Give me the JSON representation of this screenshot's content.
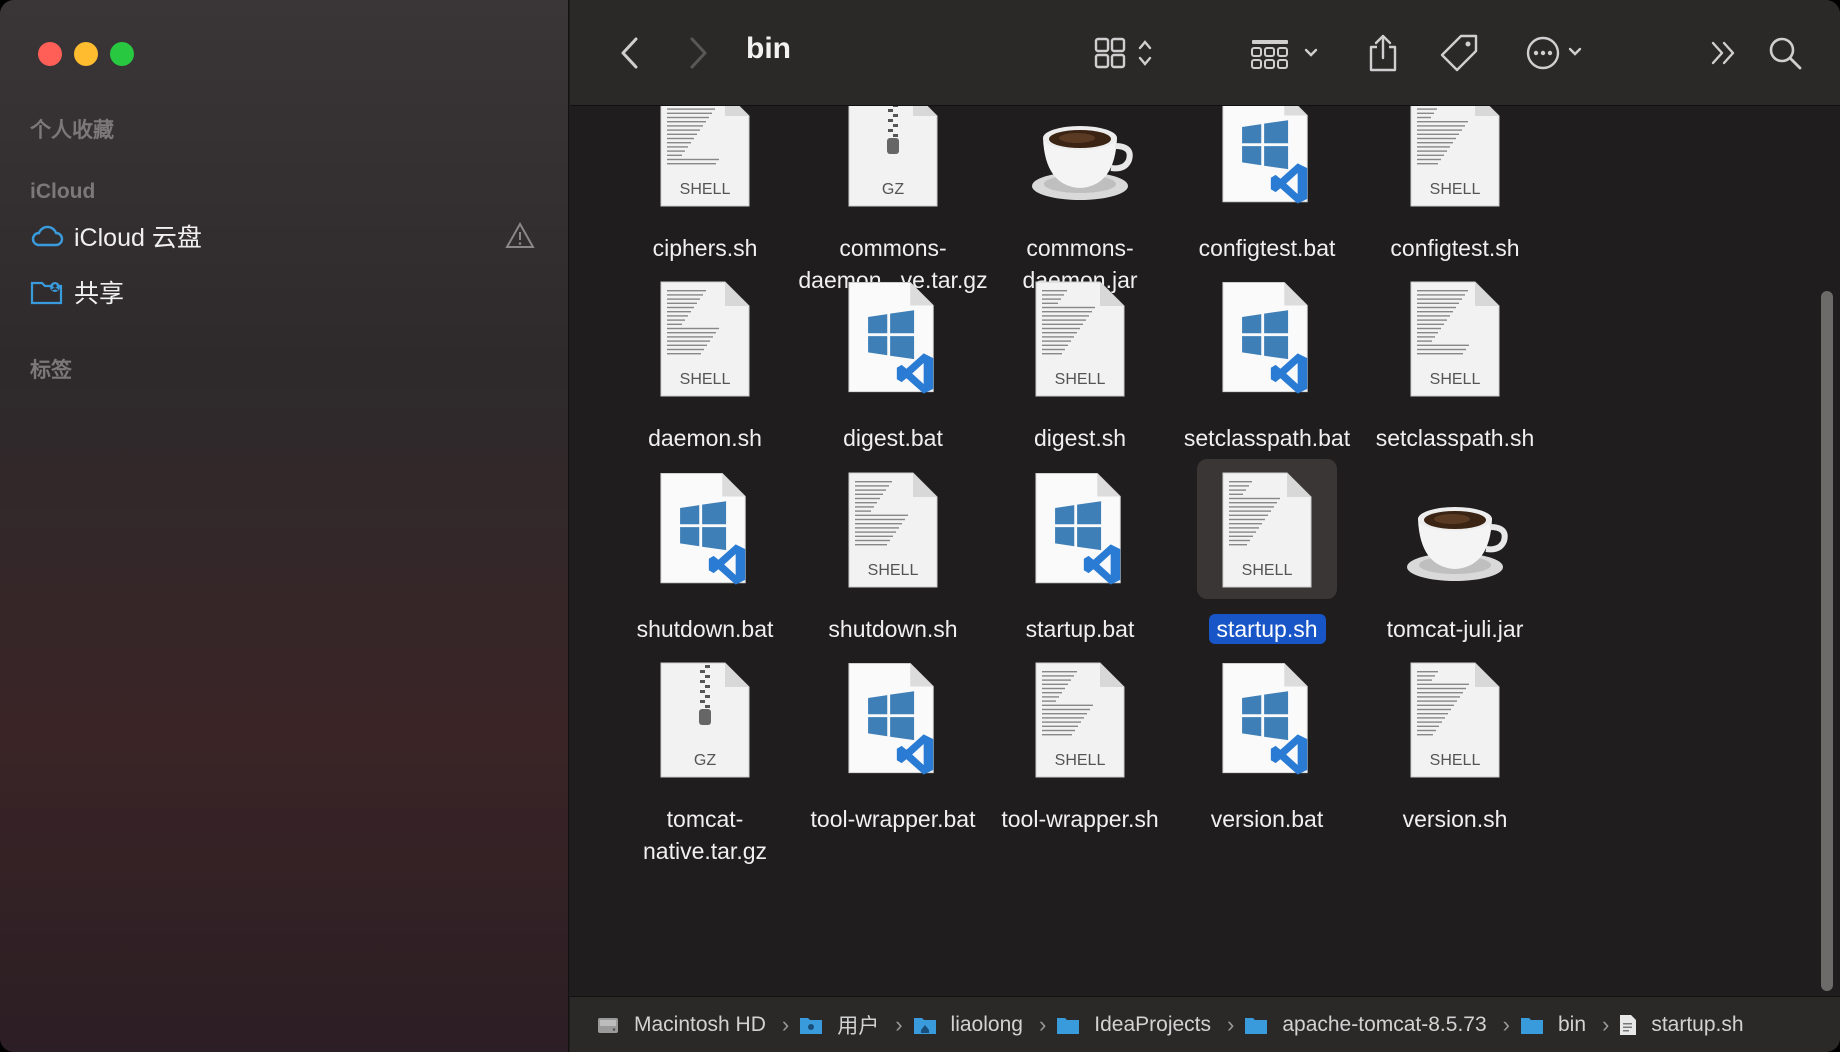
{
  "sidebar": {
    "favorites_header": "个人收藏",
    "icloud_header": "iCloud",
    "items": [
      {
        "label": "iCloud 云盘",
        "icon": "cloud-icon"
      },
      {
        "label": "共享",
        "icon": "shared-folder-icon"
      }
    ],
    "tags_header": "标签"
  },
  "toolbar": {
    "title": "bin",
    "icons": [
      "back-icon",
      "forward-icon",
      "icon-view-icon",
      "group-icon",
      "share-icon",
      "tag-icon",
      "more-icon",
      "overflow-icon",
      "search-icon"
    ]
  },
  "files": [
    {
      "name": "ciphers.sh",
      "type": "shell"
    },
    {
      "name": "commons-daemon...ve.tar.gz",
      "line1": "commons-",
      "line2": "daemon...ve.tar.gz",
      "type": "gz"
    },
    {
      "name": "commons-daemon.jar",
      "line1": "commons-",
      "line2": "daemon.jar",
      "type": "jar"
    },
    {
      "name": "configtest.bat",
      "type": "bat"
    },
    {
      "name": "configtest.sh",
      "type": "shell"
    },
    {
      "name": "daemon.sh",
      "type": "shell"
    },
    {
      "name": "digest.bat",
      "type": "bat"
    },
    {
      "name": "digest.sh",
      "type": "shell"
    },
    {
      "name": "setclasspath.bat",
      "type": "bat"
    },
    {
      "name": "setclasspath.sh",
      "type": "shell"
    },
    {
      "name": "shutdown.bat",
      "type": "bat"
    },
    {
      "name": "shutdown.sh",
      "type": "shell"
    },
    {
      "name": "startup.bat",
      "type": "bat"
    },
    {
      "name": "startup.sh",
      "type": "shell",
      "selected": true
    },
    {
      "name": "tomcat-juli.jar",
      "type": "jar"
    },
    {
      "name": "tomcat-native.tar.gz",
      "line1": "tomcat-",
      "line2": "native.tar.gz",
      "type": "gz"
    },
    {
      "name": "tool-wrapper.bat",
      "type": "bat"
    },
    {
      "name": "tool-wrapper.sh",
      "type": "shell"
    },
    {
      "name": "version.bat",
      "type": "bat"
    },
    {
      "name": "version.sh",
      "type": "shell"
    }
  ],
  "labels": {
    "shell": "SHELL",
    "gz": "GZ"
  },
  "pathbar": [
    {
      "label": "Macintosh HD",
      "icon": "hard-drive-icon"
    },
    {
      "label": "用户",
      "icon": "users-folder-icon"
    },
    {
      "label": "liaolong",
      "icon": "home-folder-icon"
    },
    {
      "label": "IdeaProjects",
      "icon": "folder-icon"
    },
    {
      "label": "apache-tomcat-8.5.73",
      "icon": "folder-icon"
    },
    {
      "label": "bin",
      "icon": "folder-icon"
    },
    {
      "label": "startup.sh",
      "icon": "document-icon"
    }
  ],
  "colors": {
    "accent": "#1856c8",
    "folder": "#3a9bdc",
    "vscode": "#2a7bd4"
  }
}
